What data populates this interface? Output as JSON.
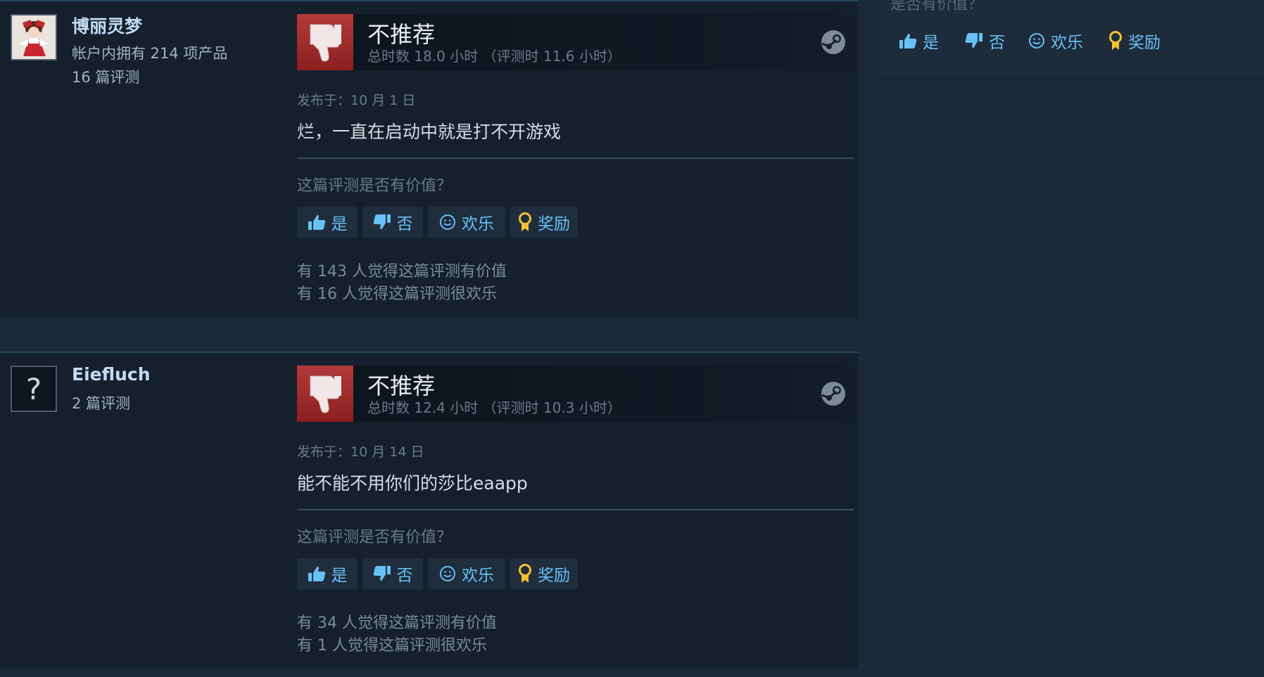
{
  "reviews": [
    {
      "username": "博丽灵梦",
      "products": "帐户内拥有 214 项产品",
      "review_count": "16 篇评测",
      "verdict": "不推荐",
      "hours": "总时数 18.0 小时 （评测时 11.6 小时）",
      "posted": "发布于：10 月 1 日",
      "content": "烂，一直在启动中就是打不开游戏",
      "helpful_question": "这篇评测是否有价值？",
      "buttons": {
        "yes": "是",
        "no": "否",
        "funny": "欢乐",
        "award": "奖励"
      },
      "helpful_stat": "有 143 人觉得这篇评测有价值",
      "funny_stat": "有 16 人觉得这篇评测很欢乐"
    },
    {
      "username": "Eiefluch",
      "review_count": "2 篇评测",
      "avatar_glyph": "?",
      "verdict": "不推荐",
      "hours": "总时数 12.4 小时 （评测时 10.3 小时）",
      "posted": "发布于：10 月 14 日",
      "content": "能不能不用你们的莎比eaapp",
      "helpful_question": "这篇评测是否有价值？",
      "buttons": {
        "yes": "是",
        "no": "否",
        "funny": "欢乐",
        "award": "奖励"
      },
      "helpful_stat": "有 34 人觉得这篇评测有价值",
      "funny_stat": "有 1 人觉得这篇评测很欢乐"
    }
  ],
  "side_panel": {
    "question": "是否有价值？",
    "buttons": {
      "yes": "是",
      "no": "否",
      "funny": "欢乐",
      "award": "奖励"
    }
  },
  "colors": {
    "page_bg": "#1b2838",
    "review_bg": "#16202d",
    "link_blue": "#67c1f5",
    "thumb_red": "#a62f2f",
    "award_gold": "#f5c232"
  },
  "icons": [
    "thumbs-down-icon",
    "thumbs-up-icon",
    "smiley-icon",
    "award-icon",
    "steam-logo-icon",
    "question-mark-icon"
  ]
}
